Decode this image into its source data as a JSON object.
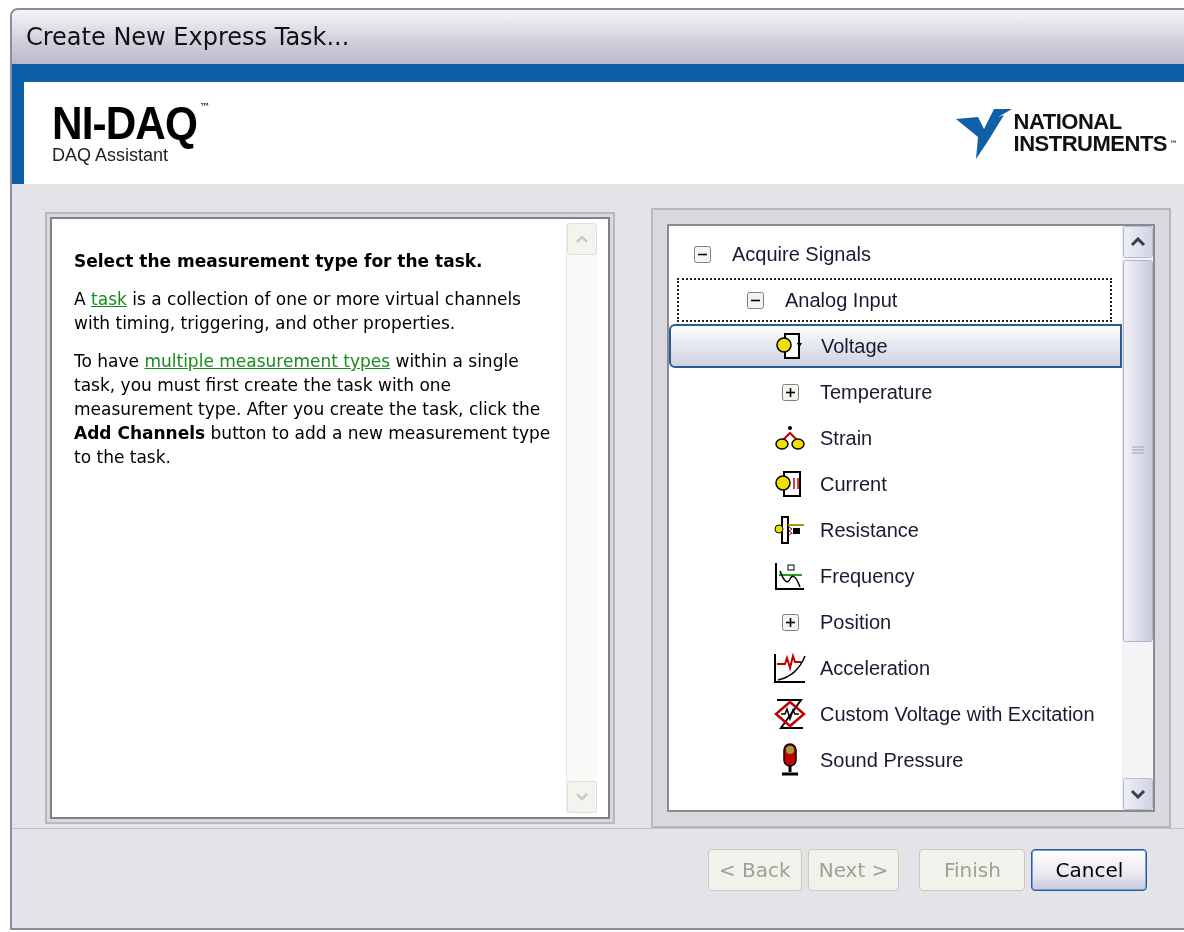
{
  "window": {
    "title": "Create New Express Task..."
  },
  "banner": {
    "product": "NI-DAQ",
    "product_mark": "™",
    "subtitle": "DAQ Assistant",
    "company_lines": [
      "NATIONAL",
      "INSTRUMENTS"
    ],
    "company_mark": "™"
  },
  "help": {
    "heading": "Select the measurement type for the task.",
    "paragraphs": [
      {
        "parts": [
          {
            "kind": "text",
            "text": "A "
          },
          {
            "kind": "link",
            "text": "task"
          },
          {
            "kind": "text",
            "text": " is a collection of one or more virtual channels with timing, triggering, and other properties."
          }
        ]
      },
      {
        "parts": [
          {
            "kind": "text",
            "text": "To have "
          },
          {
            "kind": "link",
            "text": "multiple measurement types"
          },
          {
            "kind": "text",
            "text": " within a single task, you must first create the task with one measurement type. After you create the task, click the **Add Channels** button to add a new measurement type to the task."
          }
        ]
      }
    ]
  },
  "tree": [
    {
      "label": "Acquire Signals",
      "kind": "group",
      "expanded": true,
      "selected": false,
      "focused": false,
      "children": [
        {
          "label": "Analog Input",
          "kind": "group",
          "expanded": true,
          "selected": false,
          "focused": true,
          "children": [
            {
              "label": "Voltage",
              "kind": "item",
              "selected": true,
              "focused": false
            },
            {
              "label": "Temperature",
              "kind": "group",
              "expanded": false,
              "selected": false,
              "focused": false
            },
            {
              "label": "Strain",
              "kind": "item",
              "selected": false,
              "focused": false
            },
            {
              "label": "Current",
              "kind": "item",
              "selected": false,
              "focused": false
            },
            {
              "label": "Resistance",
              "kind": "item",
              "selected": false,
              "focused": false
            },
            {
              "label": "Frequency",
              "kind": "item",
              "selected": false,
              "focused": false
            },
            {
              "label": "Position",
              "kind": "group",
              "expanded": false,
              "selected": false,
              "focused": false
            },
            {
              "label": "Acceleration",
              "kind": "item",
              "selected": false,
              "focused": false
            },
            {
              "label": "Custom Voltage with Excitation",
              "kind": "item",
              "selected": false,
              "focused": false
            },
            {
              "label": "Sound Pressure",
              "kind": "item",
              "selected": false,
              "focused": false
            }
          ]
        }
      ]
    }
  ],
  "buttons": [
    {
      "label": "< Back",
      "disabled": true,
      "default": false
    },
    {
      "label": "Next >",
      "disabled": true,
      "default": false
    },
    {
      "label": "Finish",
      "disabled": true,
      "default": false
    },
    {
      "label": "Cancel",
      "disabled": false,
      "default": true
    }
  ]
}
